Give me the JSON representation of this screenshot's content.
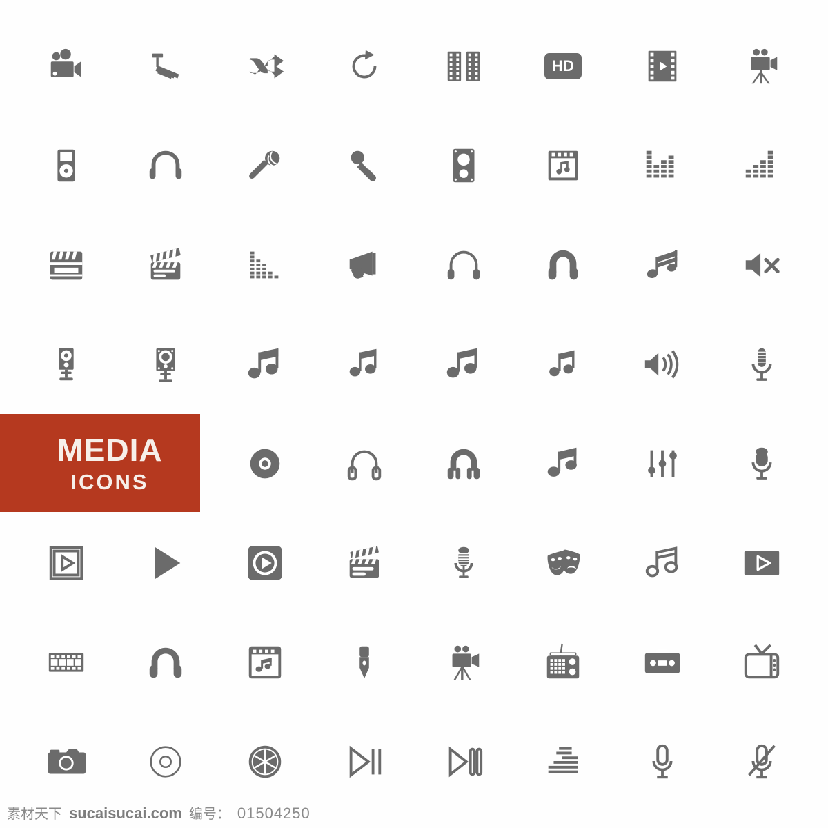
{
  "sheet": {
    "title": "Media Icons Set",
    "columns": 8,
    "rows": 8,
    "icon_color": "#6b6b6b",
    "background": "#ffffff"
  },
  "banner": {
    "title": "MEDIA",
    "subtitle": "ICONS",
    "background_color": "#b5391f",
    "text_color": "#f7efe9"
  },
  "footer": {
    "brand_cn": "素材天下",
    "site": "sucaisucai.com",
    "number_label": "编号：",
    "number_value": "01504250"
  },
  "badges": {
    "hd": "HD"
  },
  "icons": [
    {
      "row": 1,
      "col": 1,
      "name": "video-camera-icon",
      "label": "Video camera"
    },
    {
      "row": 1,
      "col": 2,
      "name": "cctv-camera-icon",
      "label": "Security camera"
    },
    {
      "row": 1,
      "col": 3,
      "name": "shuffle-icon",
      "label": "Shuffle"
    },
    {
      "row": 1,
      "col": 4,
      "name": "redo-icon",
      "label": "Redo"
    },
    {
      "row": 1,
      "col": 5,
      "name": "film-strips-icon",
      "label": "Film strips"
    },
    {
      "row": 1,
      "col": 6,
      "name": "hd-badge-icon",
      "label": "HD badge"
    },
    {
      "row": 1,
      "col": 7,
      "name": "film-play-icon",
      "label": "Film strip play"
    },
    {
      "row": 1,
      "col": 8,
      "name": "movie-camera-tripod-icon",
      "label": "Movie camera on tripod"
    },
    {
      "row": 2,
      "col": 1,
      "name": "mp3-player-icon",
      "label": "MP3 player"
    },
    {
      "row": 2,
      "col": 2,
      "name": "headphones-thin-icon",
      "label": "Headphones"
    },
    {
      "row": 2,
      "col": 3,
      "name": "microphone-diagonal-icon",
      "label": "Microphone"
    },
    {
      "row": 2,
      "col": 4,
      "name": "handheld-microphone-icon",
      "label": "Handheld microphone"
    },
    {
      "row": 2,
      "col": 5,
      "name": "speaker-cabinet-icon",
      "label": "Speaker cabinet"
    },
    {
      "row": 2,
      "col": 6,
      "name": "music-window-icon",
      "label": "Music player window"
    },
    {
      "row": 2,
      "col": 7,
      "name": "equalizer-blocks-icon",
      "label": "Equalizer blocks"
    },
    {
      "row": 2,
      "col": 8,
      "name": "equalizer-blocks-alt-icon",
      "label": "Equalizer blocks alt"
    },
    {
      "row": 3,
      "col": 1,
      "name": "clapperboard-closed-icon",
      "label": "Clapperboard closed"
    },
    {
      "row": 3,
      "col": 2,
      "name": "clapperboard-open-icon",
      "label": "Clapperboard open"
    },
    {
      "row": 3,
      "col": 3,
      "name": "equalizer-bars-icon",
      "label": "Equalizer bars"
    },
    {
      "row": 3,
      "col": 4,
      "name": "megaphone-icon",
      "label": "Megaphone"
    },
    {
      "row": 3,
      "col": 5,
      "name": "headphones-outline-icon",
      "label": "Headphones outline"
    },
    {
      "row": 3,
      "col": 6,
      "name": "headphones-bold-icon",
      "label": "Headphones bold"
    },
    {
      "row": 3,
      "col": 7,
      "name": "music-note-beamed-icon",
      "label": "Beamed music notes"
    },
    {
      "row": 3,
      "col": 8,
      "name": "speaker-mute-icon",
      "label": "Speaker mute"
    },
    {
      "row": 4,
      "col": 1,
      "name": "monitor-speaker-stand-icon",
      "label": "Monitor speaker on stand"
    },
    {
      "row": 4,
      "col": 2,
      "name": "monitor-speaker-stand-alt-icon",
      "label": "Monitor speaker alt"
    },
    {
      "row": 4,
      "col": 3,
      "name": "music-note-pair-icon",
      "label": "Music notes"
    },
    {
      "row": 4,
      "col": 4,
      "name": "music-note-pair-slim-icon",
      "label": "Music notes slim"
    },
    {
      "row": 4,
      "col": 5,
      "name": "music-note-pair-wide-icon",
      "label": "Music notes wide"
    },
    {
      "row": 4,
      "col": 6,
      "name": "music-note-pair-small-icon",
      "label": "Music notes small"
    },
    {
      "row": 4,
      "col": 7,
      "name": "volume-up-icon",
      "label": "Volume up"
    },
    {
      "row": 4,
      "col": 8,
      "name": "studio-microphone-icon",
      "label": "Studio microphone"
    },
    {
      "row": 5,
      "col": 1,
      "name": "banner-media-icons",
      "label": "MEDIA ICONS banner"
    },
    {
      "row": 5,
      "col": 3,
      "name": "compact-disc-icon",
      "label": "Compact disc"
    },
    {
      "row": 5,
      "col": 4,
      "name": "headset-outline-icon",
      "label": "Headset outline"
    },
    {
      "row": 5,
      "col": 5,
      "name": "headset-filled-icon",
      "label": "Headset filled"
    },
    {
      "row": 5,
      "col": 6,
      "name": "music-note-single-icon",
      "label": "Music note"
    },
    {
      "row": 5,
      "col": 7,
      "name": "sliders-icon",
      "label": "Sliders"
    },
    {
      "row": 5,
      "col": 8,
      "name": "vintage-microphone-icon",
      "label": "Vintage microphone"
    },
    {
      "row": 6,
      "col": 1,
      "name": "video-frame-play-icon",
      "label": "Video frame play"
    },
    {
      "row": 6,
      "col": 2,
      "name": "play-triangle-icon",
      "label": "Play"
    },
    {
      "row": 6,
      "col": 3,
      "name": "play-rounded-square-icon",
      "label": "Play button square"
    },
    {
      "row": 6,
      "col": 4,
      "name": "clapperboard-filled-icon",
      "label": "Clapperboard"
    },
    {
      "row": 6,
      "col": 5,
      "name": "retro-microphone-icon",
      "label": "Retro microphone"
    },
    {
      "row": 6,
      "col": 6,
      "name": "theater-masks-icon",
      "label": "Theater masks"
    },
    {
      "row": 6,
      "col": 7,
      "name": "music-note-outline-icon",
      "label": "Music note outline"
    },
    {
      "row": 6,
      "col": 8,
      "name": "video-play-button-icon",
      "label": "Video play button"
    },
    {
      "row": 7,
      "col": 1,
      "name": "film-strip-horizontal-icon",
      "label": "Film strip"
    },
    {
      "row": 7,
      "col": 2,
      "name": "headphones-solid-icon",
      "label": "Headphones solid"
    },
    {
      "row": 7,
      "col": 3,
      "name": "music-app-window-icon",
      "label": "Music app window"
    },
    {
      "row": 7,
      "col": 4,
      "name": "microphone-solid-icon",
      "label": "Microphone"
    },
    {
      "row": 7,
      "col": 5,
      "name": "movie-camera-stand-icon",
      "label": "Movie camera stand"
    },
    {
      "row": 7,
      "col": 6,
      "name": "radio-icon",
      "label": "Radio"
    },
    {
      "row": 7,
      "col": 7,
      "name": "cassette-tape-icon",
      "label": "Cassette tape"
    },
    {
      "row": 7,
      "col": 8,
      "name": "retro-tv-icon",
      "label": "Retro television"
    },
    {
      "row": 8,
      "col": 1,
      "name": "photo-camera-icon",
      "label": "Photo camera"
    },
    {
      "row": 8,
      "col": 2,
      "name": "disc-outline-icon",
      "label": "Disc outline"
    },
    {
      "row": 8,
      "col": 3,
      "name": "aperture-icon",
      "label": "Aperture"
    },
    {
      "row": 8,
      "col": 4,
      "name": "play-pause-outline-icon",
      "label": "Play pause"
    },
    {
      "row": 8,
      "col": 5,
      "name": "play-pause-outline-alt-icon",
      "label": "Play pause alt"
    },
    {
      "row": 8,
      "col": 6,
      "name": "equalizer-lines-icon",
      "label": "Equalizer lines"
    },
    {
      "row": 8,
      "col": 7,
      "name": "microphone-outline-icon",
      "label": "Microphone outline"
    },
    {
      "row": 8,
      "col": 8,
      "name": "microphone-muted-icon",
      "label": "Microphone muted"
    }
  ]
}
